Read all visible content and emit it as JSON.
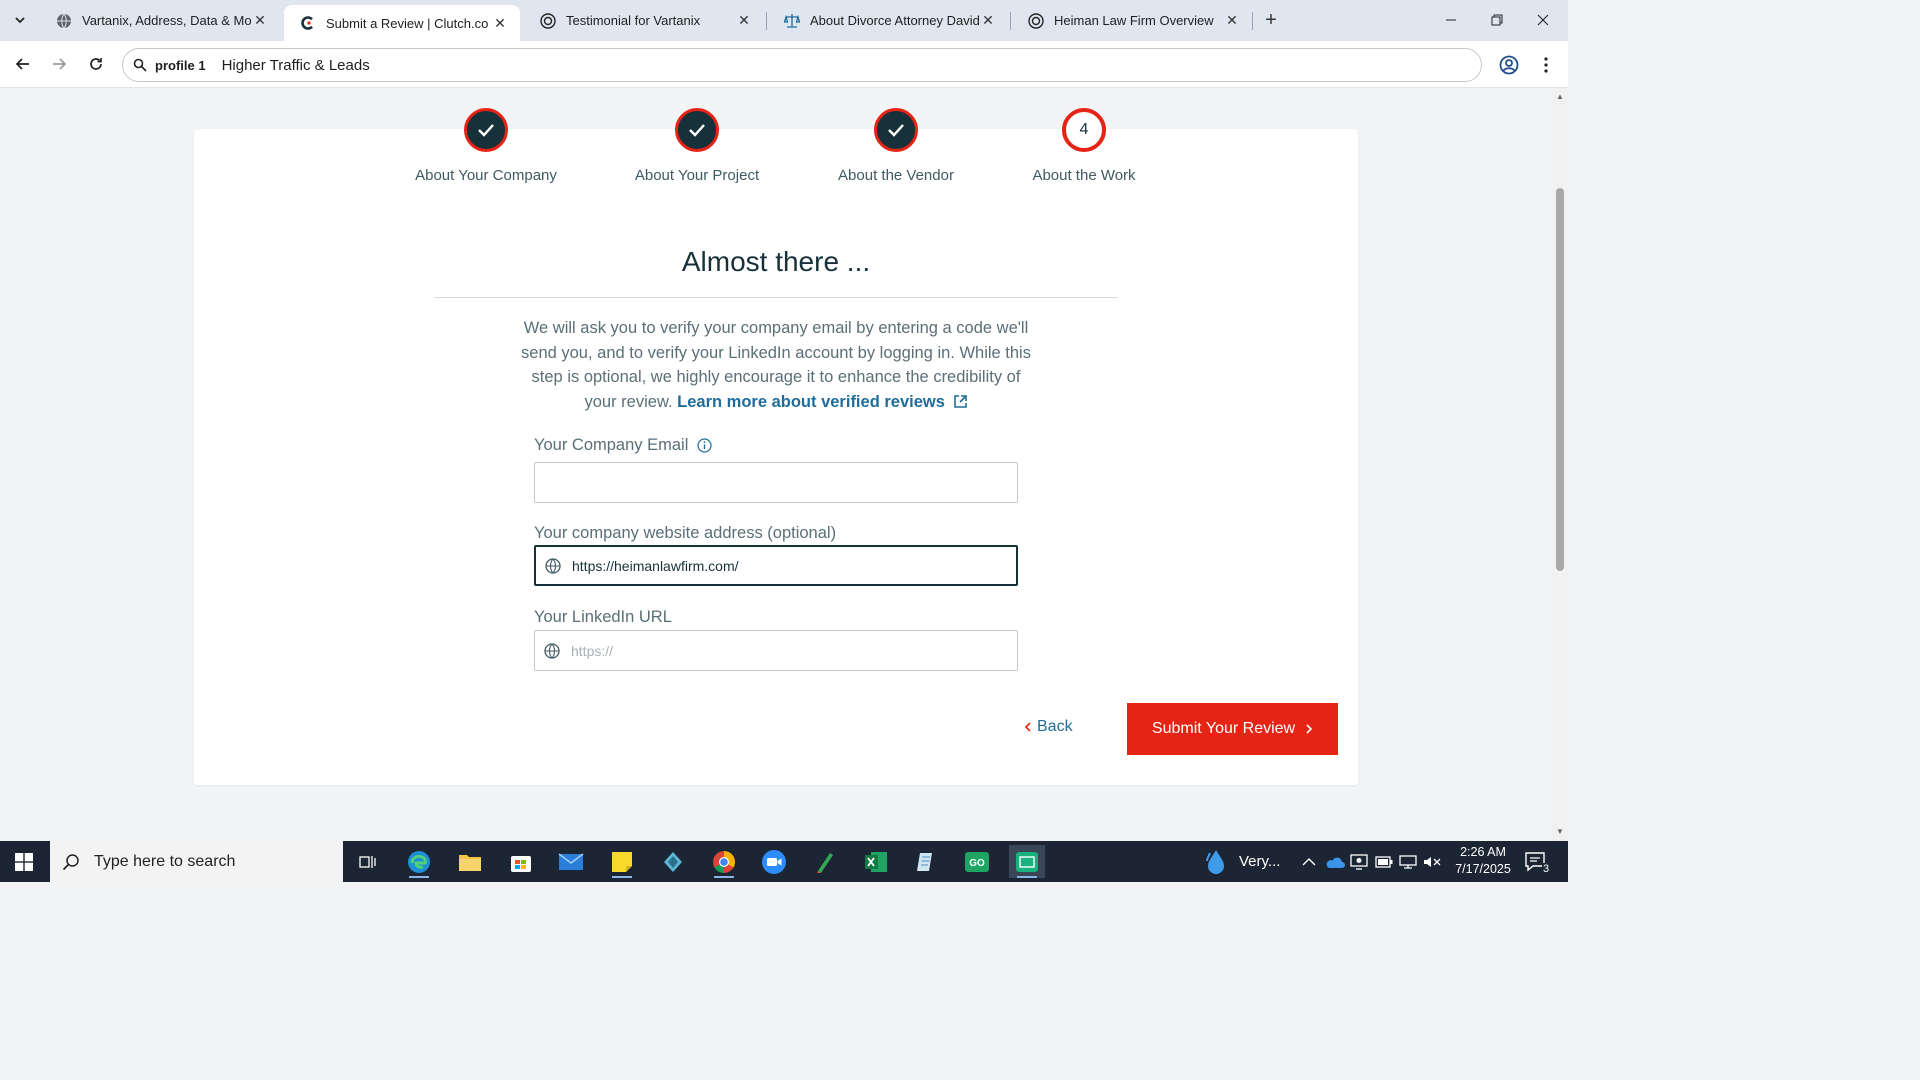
{
  "browser": {
    "tabs": [
      {
        "title": "Vartanix, Address, Data & More",
        "icon": "globe-icon",
        "active": false
      },
      {
        "title": "Submit a Review | Clutch.co",
        "icon": "clutch-logo-icon",
        "active": true
      },
      {
        "title": "Testimonial for Vartanix",
        "icon": "openai-icon",
        "active": false
      },
      {
        "title": "About Divorce Attorney David H",
        "icon": "scales-icon",
        "active": false
      },
      {
        "title": "Heiman Law Firm Overview",
        "icon": "openai-icon",
        "active": false
      }
    ],
    "omnibox": {
      "chip": "profile 1",
      "text": "Higher Traffic & Leads"
    }
  },
  "steps": [
    {
      "label": "About Your Company",
      "state": "done"
    },
    {
      "label": "About Your Project",
      "state": "done"
    },
    {
      "label": "About the Vendor",
      "state": "done"
    },
    {
      "label": "About the Work",
      "state": "current",
      "number": "4"
    }
  ],
  "form": {
    "heading": "Almost there ...",
    "intro_text": "We will ask you to verify your company email by entering a code we'll send you, and to verify your LinkedIn account by logging in. While this step is optional, we highly encourage it to enhance the credibility of your review.",
    "intro_link": "Learn more about verified reviews",
    "email_label": "Your Company Email",
    "email_value": "",
    "website_label": "Your company website address (optional)",
    "website_value": "https://heimanlawfirm.com/",
    "linkedin_label": "Your LinkedIn URL",
    "linkedin_value": "",
    "linkedin_placeholder": "https://",
    "back_label": "Back",
    "submit_label": "Submit Your Review"
  },
  "taskbar": {
    "search_placeholder": "Type here to search",
    "weather_text": "Very...",
    "time": "2:26 AM",
    "date": "7/17/2025",
    "notification_count": "3"
  },
  "colors": {
    "accent_red": "#e62415",
    "dark_navy": "#17313b",
    "link_blue": "#1f6d9b"
  }
}
